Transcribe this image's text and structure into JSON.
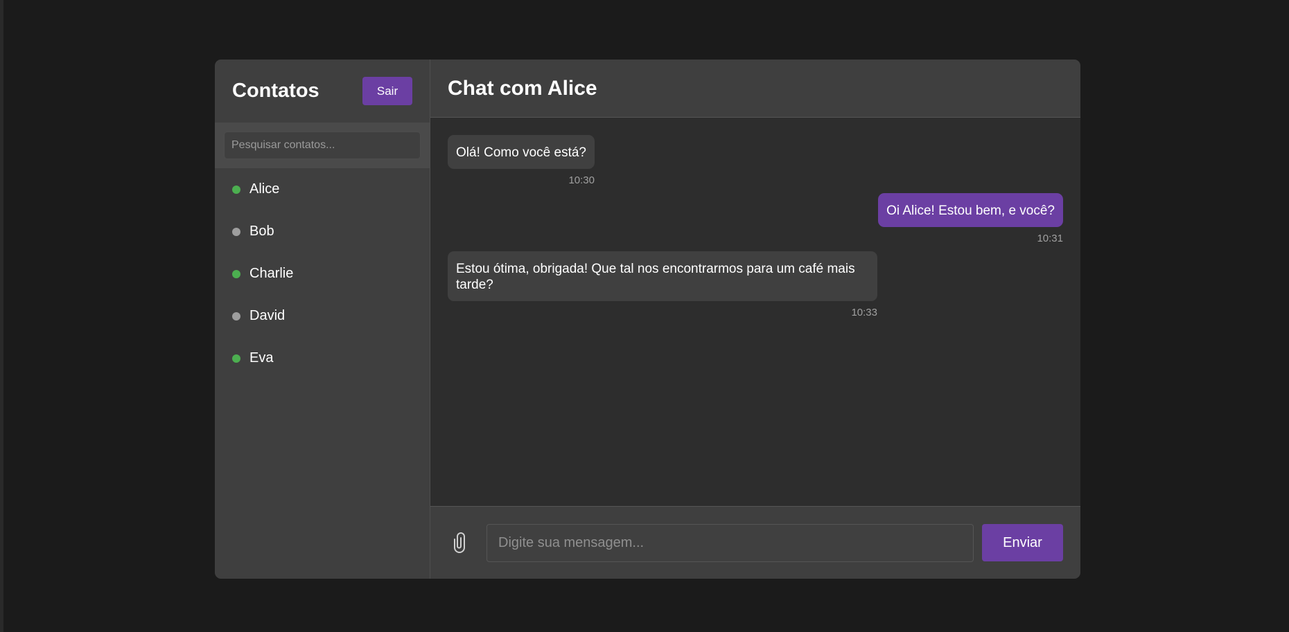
{
  "sidebar": {
    "title": "Contatos",
    "logout_label": "Sair",
    "search_placeholder": "Pesquisar contatos...",
    "contacts": [
      {
        "name": "Alice",
        "status": "online"
      },
      {
        "name": "Bob",
        "status": "offline"
      },
      {
        "name": "Charlie",
        "status": "online"
      },
      {
        "name": "David",
        "status": "offline"
      },
      {
        "name": "Eva",
        "status": "online"
      }
    ]
  },
  "chat": {
    "title": "Chat com Alice",
    "messages": [
      {
        "direction": "received",
        "text": "Olá! Como você está?",
        "time": "10:30"
      },
      {
        "direction": "sent",
        "text": "Oi Alice! Estou bem, e você?",
        "time": "10:31"
      },
      {
        "direction": "received",
        "text": "Estou ótima, obrigada! Que tal nos encontrarmos para um café mais tarde?",
        "time": "10:33"
      }
    ],
    "input_placeholder": "Digite sua mensagem...",
    "send_label": "Enviar",
    "attach_icon": "paperclip-icon"
  },
  "colors": {
    "accent": "#6b3fa3",
    "online": "#4caf50",
    "offline": "#9e9e9e"
  }
}
